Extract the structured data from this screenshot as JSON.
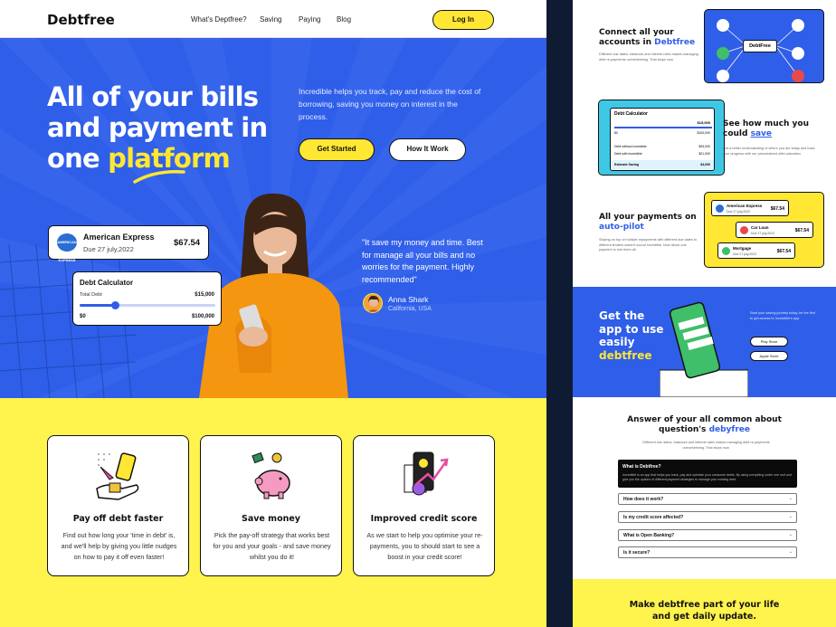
{
  "nav": {
    "logo": "Debtfree",
    "links": [
      "What's Deptfree?",
      "Saving",
      "Paying",
      "Blog"
    ],
    "login": "Log In"
  },
  "hero": {
    "title_part1": "All of your bills and payment in one ",
    "title_highlight": "platform",
    "description": "Incredible helps you track, pay and reduce the cost of borrowing, saving you money on interest in the process.",
    "btn_start": "Get Started",
    "btn_how": "How It Work",
    "amex": {
      "logo": "AMERICAN EXPRESS",
      "name": "American Express",
      "due": "Due 27 july,2022",
      "amount": "$67.54"
    },
    "calc": {
      "title": "Debt Calculator",
      "label": "Total Debt",
      "max_top": "$15,000",
      "min": "$0",
      "max": "$100,000",
      "progress": 0.26
    },
    "quote": "\"It save my money and time. Best for manage all your bills and no worries for the payment. Highly recommended\"",
    "quote_name": "Anna Shark",
    "quote_loc": "California, USA"
  },
  "features": [
    {
      "title": "Pay off debt faster",
      "desc": "Find out how long your 'time in debt' is, and we'll help by giving you little nudges on how to pay it off even faster!",
      "icon": "hand-coin-icon"
    },
    {
      "title": "Save money",
      "desc": "Pick the pay-off strategy that works best for you and your goals - and save money whilst you do it!",
      "icon": "piggy-bank-icon"
    },
    {
      "title": "Improved credit score",
      "desc": "As we start to help you optimise your re-payments, you to should start to see a boost in your credit score!",
      "icon": "phone-growth-icon"
    }
  ],
  "right": {
    "connect": {
      "title1": "Connect all your",
      "title2": "accounts in ",
      "title_hl": "Debtfree",
      "desc": "Different due dates, balances and interest rates makes managing debt re-payments overwhelming. That stops now.",
      "center": "DebtFree"
    },
    "calc": {
      "title1": "See how much you",
      "title2": "could ",
      "title_hl": "save",
      "desc": "Get a better understanding of where you are today and track your progress with our personalized debt calculator.",
      "card_title": "Debt Calculator",
      "card_max": "$15,000",
      "card_zero": "$0",
      "card_hundred": "$100,000",
      "rows": [
        {
          "label": "Debt without Incredible",
          "value": "$25,000"
        },
        {
          "label": "Debt with Incredible",
          "value": "$21,000"
        },
        {
          "label": "Estimate Saving",
          "value": "$4,000"
        }
      ]
    },
    "pay": {
      "title1": "All your payments on",
      "title_hl": "auto-pilot",
      "desc": "Staying on top of multiple repayments with different due dates to different lenders doesn't sound incredible. Now about one payment to rule them all.",
      "cards": [
        {
          "name": "American Express",
          "due": "Due 27 july,2022",
          "amount": "$67.54"
        },
        {
          "name": "Car Loan",
          "due": "Due 27 july,2022",
          "amount": "$67.54"
        },
        {
          "name": "Mortgage",
          "due": "Due 27 july,2022",
          "amount": "$67.54"
        }
      ]
    },
    "app": {
      "title1": "Get the",
      "title2": "app to use",
      "title3": "easily",
      "title_hl": "debtfree",
      "desc": "Start your saving journey today, be the first to get access to Incredible's app.",
      "play": "Play Store",
      "apple": "Apple Store"
    },
    "faq": {
      "title1": "Answer of your all common about",
      "title2": "question's ",
      "title_hl": "debyfree",
      "sub": "Different due dates, balances and interest rates makes managing debt re-payments overwhelming. That stops now.",
      "open_q": "What is Debtfree?",
      "open_a": "Incredible is an app that helps you track, pay and optimise your consumer debts. By using everything under one roof and give you the options of different payment strategies to manage your existing debt.",
      "items": [
        "How does it work?",
        "Is my credit score affected?",
        "What is Open Banking?",
        "Is it secure?"
      ]
    },
    "cta": {
      "line1": "Make debtfree part of your life",
      "line2": "and get daily update."
    }
  },
  "colors": {
    "blue": "#2f5ee8",
    "yellow": "#ffe733",
    "dark": "#0f1b33"
  }
}
